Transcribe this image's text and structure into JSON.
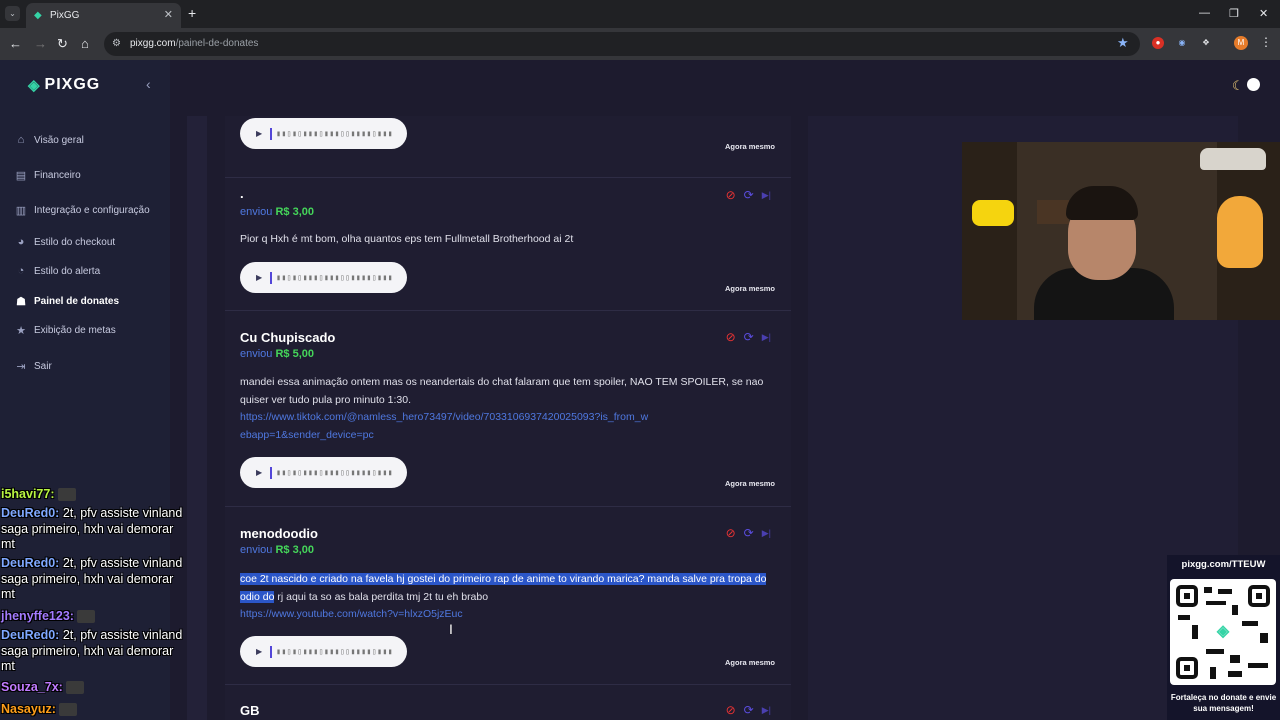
{
  "browser": {
    "tab_title": "PixGG",
    "url_host": "pixgg.com",
    "url_path": "/painel-de-donates"
  },
  "sidebar": {
    "logo": "PIXGG",
    "items": [
      {
        "label": "Visão geral",
        "icon": "home-icon"
      },
      {
        "label": "Financeiro",
        "icon": "wallet-icon"
      },
      {
        "label": "Integração e configuração",
        "icon": "settings-icon"
      },
      {
        "label": "Estilo do checkout",
        "icon": "palette-icon"
      },
      {
        "label": "Estilo do alerta",
        "icon": "alert-icon"
      },
      {
        "label": "Painel de donates",
        "icon": "donate-icon"
      },
      {
        "label": "Exibição de metas",
        "icon": "star-icon"
      },
      {
        "label": "Sair",
        "icon": "logout-icon"
      }
    ],
    "active_index": 5
  },
  "feed": {
    "donations": [
      {
        "name": "",
        "sent_label": "",
        "amount": "",
        "message": "",
        "time": "Agora mesmo"
      },
      {
        "name": ".",
        "sent_label": "enviou",
        "amount": "R$ 3,00",
        "message": "Pior q Hxh é mt bom, olha quantos eps tem Fullmetall Brotherhood ai 2t",
        "time": "Agora mesmo"
      },
      {
        "name": "Cu Chupiscado",
        "sent_label": "enviou",
        "amount": "R$ 5,00",
        "message": "mandei essa animação ontem mas os neandertais do chat falaram que tem spoiler, NAO TEM SPOILER, se nao quiser ver tudo pula pro minuto 1:30.",
        "link": "https://www.tiktok.com/@namless_hero73497/video/7033106937420025093?is_from_webapp=1&sender_device=pc",
        "time": "Agora mesmo"
      },
      {
        "name": "menodoodio",
        "sent_label": "enviou",
        "amount": "R$ 3,00",
        "message_highlight": "coe 2t nascido e criado na favela hj gostei do primeiro rap de anime to virando marica? manda salve pra tropa do odio do",
        "message_rest": " rj aqui ta so as bala perdita tmj 2t tu eh brabo",
        "link": "https://www.youtube.com/watch?v=hlxzO5jzEuc",
        "time": "Agora mesmo"
      },
      {
        "name": "GB"
      }
    ],
    "waveform": "▮▮▯▮▯▮▮▮▯▮▮▮▯▯▮▮▮▮▯▮▮▮"
  },
  "chat": [
    {
      "user": "i5havi77:",
      "color": "#b8f542",
      "text": ""
    },
    {
      "user": "DeuRed0:",
      "color": "#7fa8ff",
      "text": "2t, pfv assiste vinland saga primeiro, hxh vai demorar mt"
    },
    {
      "user": "DeuRed0:",
      "color": "#7fa8ff",
      "text": "2t, pfv assiste vinland saga primeiro, hxh vai demorar mt"
    },
    {
      "user": "jhenyffe123:",
      "color": "#a37bff",
      "text": ""
    },
    {
      "user": "DeuRed0:",
      "color": "#7fa8ff",
      "text": "2t, pfv assiste vinland saga primeiro, hxh vai demorar mt"
    },
    {
      "user": "Souza_7x:",
      "color": "#c07bff",
      "text": ""
    },
    {
      "user": "Nasayuz:",
      "color": "#ff9f1a",
      "text": ""
    }
  ],
  "qr_widget": {
    "url": "pixgg.com/TTEUW",
    "caption": "Fortaleça no donate e envie sua mensagem!"
  }
}
